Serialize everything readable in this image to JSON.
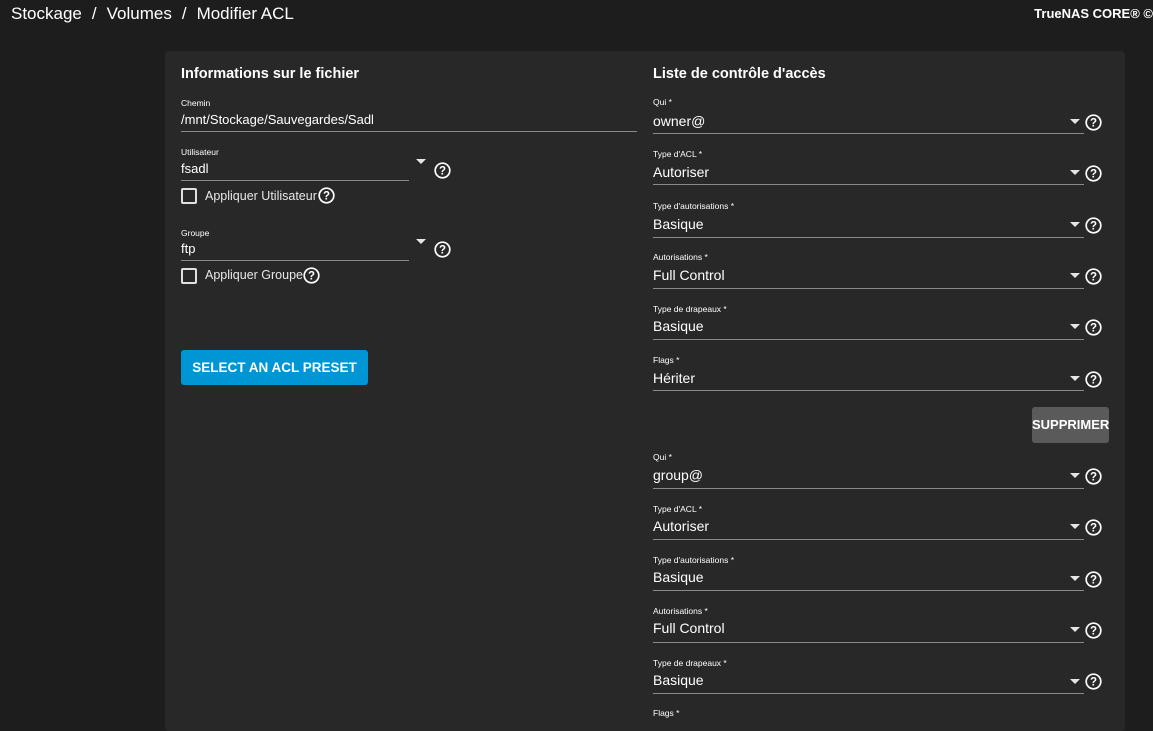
{
  "breadcrumb": [
    "Stockage",
    "Volumes",
    "Modifier ACL"
  ],
  "breadcrumb_separator": "/",
  "brand": "TrueNAS CORE® ©",
  "file_info": {
    "title": "Informations sur le fichier",
    "path_label": "Chemin",
    "path_value": "/mnt/Stockage/Sauvegardes/Sadl",
    "user_label": "Utilisateur",
    "user_value": "fsadl",
    "apply_user_label": "Appliquer Utilisateur",
    "group_label": "Groupe",
    "group_value": "ftp",
    "apply_group_label": "Appliquer Groupe",
    "preset_button": "SELECT AN ACL PRESET"
  },
  "acl": {
    "title": "Liste de contrôle d'accès",
    "delete_button": "SUPPRIMER",
    "entries": [
      {
        "who_label": "Qui *",
        "who": "owner@",
        "acl_type_label": "Type d'ACL *",
        "acl_type": "Autoriser",
        "perm_type_label": "Type d'autorisations *",
        "perm_type": "Basique",
        "perms_label": "Autorisations *",
        "perms": "Full Control",
        "flag_type_label": "Type de drapeaux *",
        "flag_type": "Basique",
        "flags_label": "Flags *",
        "flags": "Hériter"
      },
      {
        "who_label": "Qui *",
        "who": "group@",
        "acl_type_label": "Type d'ACL *",
        "acl_type": "Autoriser",
        "perm_type_label": "Type d'autorisations *",
        "perm_type": "Basique",
        "perms_label": "Autorisations *",
        "perms": "Full Control",
        "flag_type_label": "Type de drapeaux *",
        "flag_type": "Basique",
        "flags_label": "Flags *"
      }
    ]
  },
  "colors": {
    "background": "#1d1d1d",
    "card": "#282828",
    "primary_button": "#0095d5",
    "secondary_button": "#5a5a5a"
  },
  "icons": {
    "help": "help-circle-icon",
    "dropdown": "caret-down-icon",
    "checkbox": "checkbox-unchecked"
  }
}
